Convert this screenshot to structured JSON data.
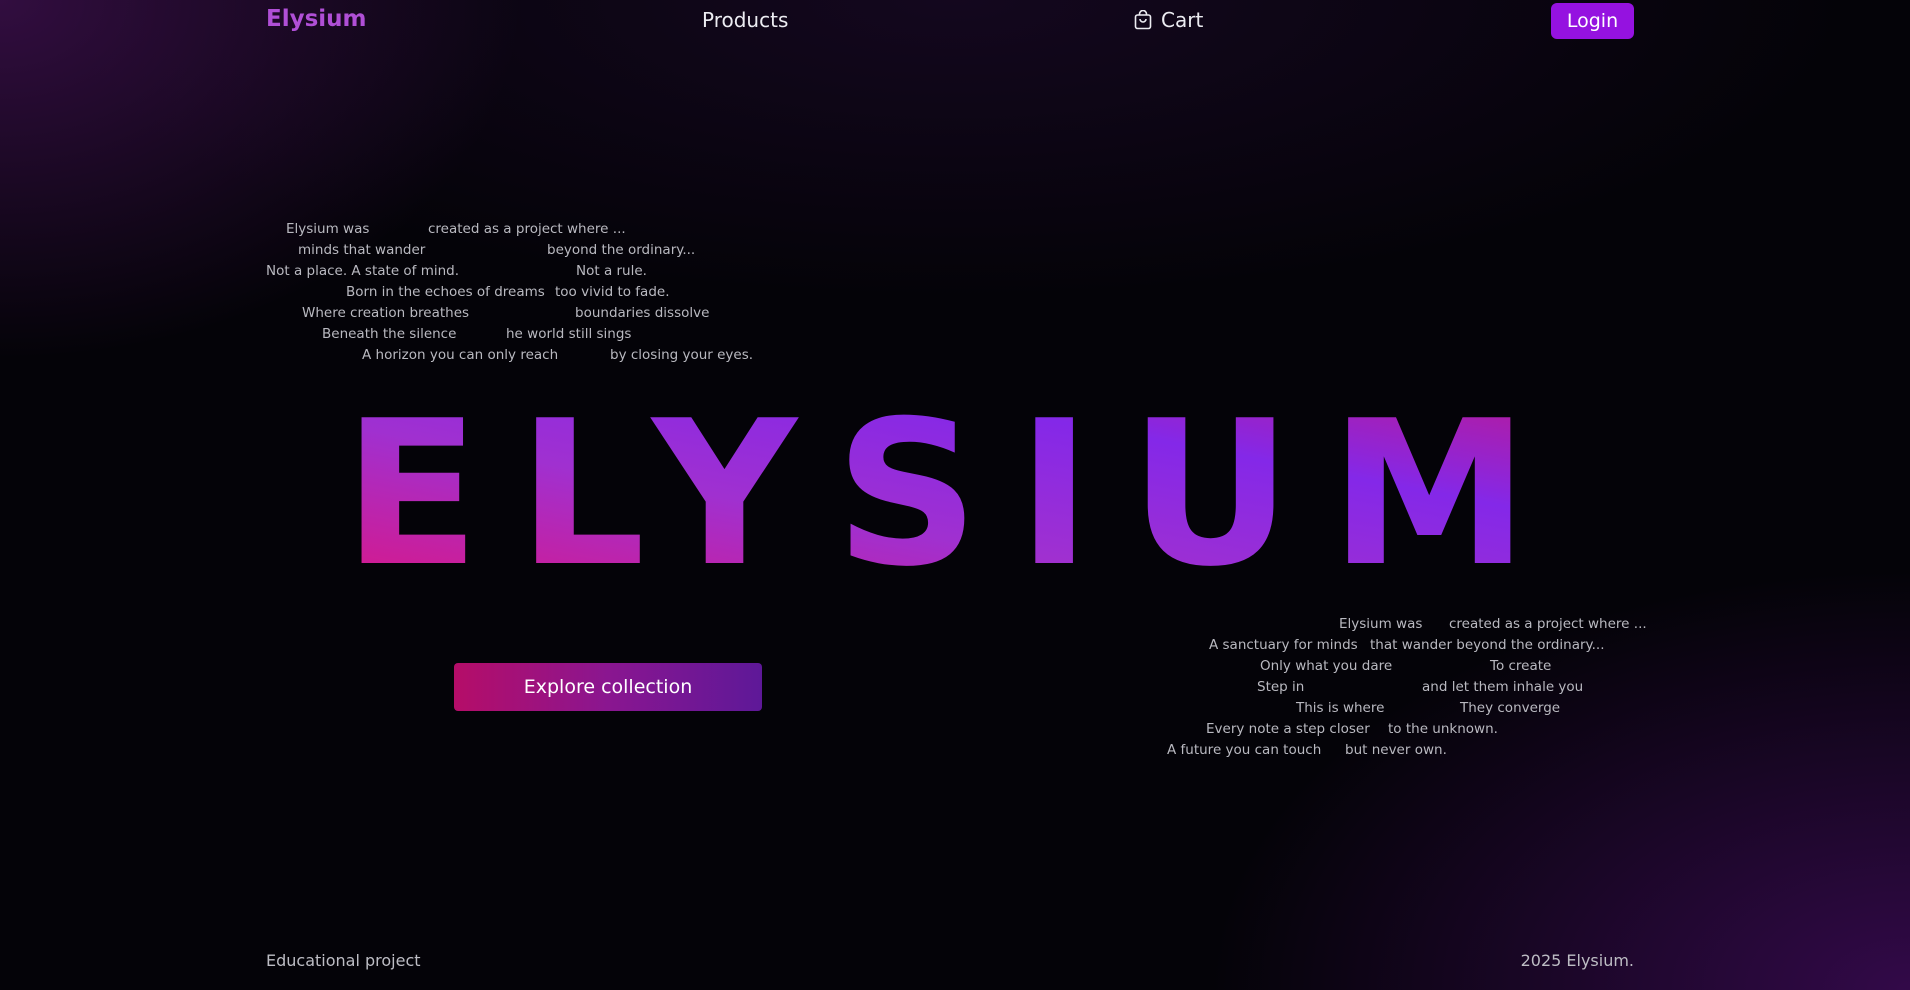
{
  "nav": {
    "brand": "Elysium",
    "products": "Products",
    "cart": "Cart",
    "cart_icon": "shopping-bag-icon",
    "login": "Login"
  },
  "poem_top": [
    [
      "Elysium was",
      "created as a project where ..."
    ],
    [
      "minds that wander",
      "beyond the ordinary..."
    ],
    [
      "Not a place. A state of mind.",
      "Not a rule."
    ],
    [
      "Born in the echoes of dreams",
      "too vivid to fade."
    ],
    [
      "Where creation breathes",
      "boundaries dissolve"
    ],
    [
      "Beneath the silence",
      "he world still sings"
    ],
    [
      "A horizon you can only reach",
      "by closing your eyes."
    ]
  ],
  "hero": {
    "title": "ELYSIUM",
    "gradient": [
      "#e0157f",
      "#a030d0",
      "#8428e8",
      "#c0188c"
    ]
  },
  "cta": {
    "label": "Explore collection"
  },
  "poem_bottom": [
    [
      "Elysium was",
      "created as a project where ..."
    ],
    [
      "A sanctuary for minds",
      "that wander beyond the ordinary..."
    ],
    [
      "Only what you dare",
      "To create"
    ],
    [
      "Step in",
      "and let them inhale you"
    ],
    [
      "This is where",
      "They converge"
    ],
    [
      "Every note a step closer",
      "to the unknown."
    ],
    [
      "A future you can touch",
      "but never own."
    ]
  ],
  "footer": {
    "left": "Educational project",
    "right": "2025 Elysium."
  },
  "colors": {
    "accent": "#9512e0",
    "brand": "#b04fd6",
    "background": "#040308"
  }
}
